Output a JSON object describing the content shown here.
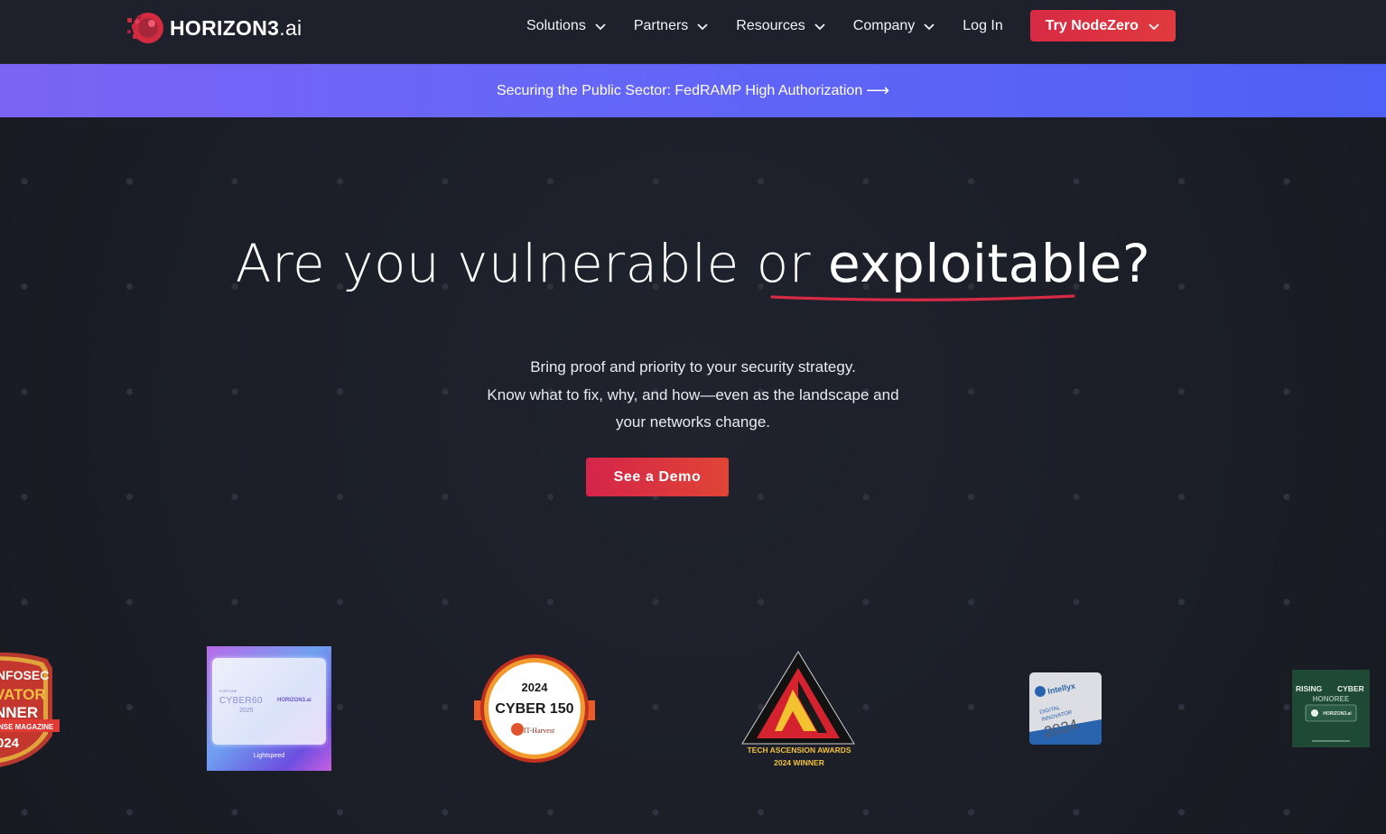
{
  "nav": {
    "logo_text": "HORIZON3",
    "logo_suffix": ".ai",
    "items": [
      {
        "label": "Solutions"
      },
      {
        "label": "Partners"
      },
      {
        "label": "Resources"
      },
      {
        "label": "Company"
      }
    ],
    "login": "Log In",
    "cta": "Try NodeZero"
  },
  "banner": {
    "text": "Securing the Public Sector: FedRAMP High Authorization",
    "arrow": "⟶"
  },
  "hero": {
    "headline_prefix": "Are you vulnerable or ",
    "headline_highlight": "exploitable?",
    "sub_line1": "Bring proof and priority to your security strategy.",
    "sub_line2": "Know what to fix, why, and how—even as the landscape and",
    "sub_line3": "your networks change.",
    "cta": "See a Demo"
  },
  "awards": {
    "infosec": {
      "l1": "NFOSEC",
      "l2": "VATOR",
      "l3": "NNER",
      "l4": "NSE MAGAZINE",
      "l5": "024"
    },
    "cyber60": {
      "small": "FORTUNE",
      "title": "CYBER60",
      "year": "2025",
      "brand": "HORIZON3.ai",
      "foot": "Lightspeed"
    },
    "cyber150": {
      "year": "2024",
      "title": "CYBER 150",
      "org": "IT-Harvest"
    },
    "tech": {
      "l1": "TECH ASCENSION AWARDS",
      "l2": "2024 WINNER"
    },
    "intellyx": {
      "brand": "Intellyx",
      "l1": "DIGITAL",
      "l2": "INNOVATOR",
      "year": "2024"
    },
    "rising": {
      "l1": "RISING",
      "l2": "CYBER",
      "l3": "HONOREE",
      "brand": "HORIZON3.ai"
    }
  },
  "colors": {
    "accent_red": "#d72a44",
    "banner_purple": "#6b63f6",
    "background": "#1c1f29"
  }
}
